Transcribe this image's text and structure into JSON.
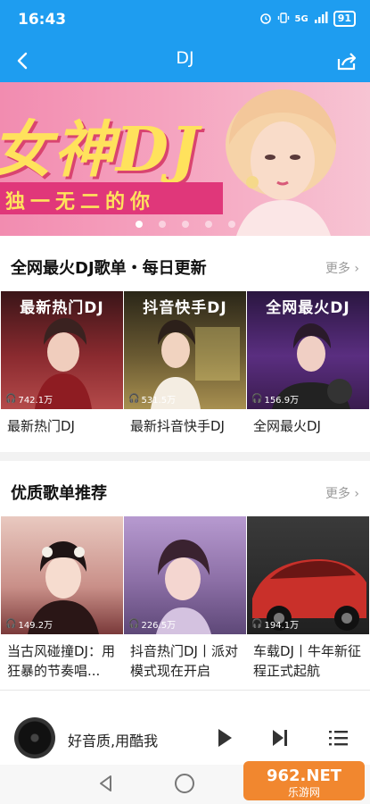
{
  "status_bar": {
    "time": "16:43",
    "network": "5G",
    "battery": "91"
  },
  "nav": {
    "title": "DJ",
    "back_icon": "chevron-left-icon",
    "share_icon": "share-icon"
  },
  "banner": {
    "title": "女神DJ",
    "subtitle": "独一无二的你",
    "dot_count": 5,
    "active_dot": 0
  },
  "section1": {
    "title": "全网最火DJ歌单・每日更新",
    "more": "更多",
    "items": [
      {
        "caption": "最新热门DJ",
        "count": "742.1万",
        "name": "最新热门DJ",
        "color": "#8a2a2f"
      },
      {
        "caption": "抖音快手DJ",
        "count": "531.5万",
        "name": "最新抖音快手DJ",
        "color": "#5a4a30"
      },
      {
        "caption": "全网最火DJ",
        "count": "156.9万",
        "name": "全网最火DJ",
        "color": "#4a2a6a"
      }
    ]
  },
  "section2": {
    "title": "优质歌单推荐",
    "more": "更多",
    "items": [
      {
        "count": "149.2万",
        "name": "当古风碰撞DJ：用狂暴的节奏唱...",
        "color": "#c9a3a0"
      },
      {
        "count": "226.5万",
        "name": "抖音热门DJ丨派对模式现在开启",
        "color": "#8c6fa6"
      },
      {
        "count": "194.1万",
        "name": "车载DJ丨牛年新征程正式起航",
        "color": "#c13a2e"
      }
    ]
  },
  "player": {
    "text": "好音质,用酷我",
    "play_icon": "play-icon",
    "next_icon": "skip-next-icon",
    "list_icon": "playlist-icon"
  },
  "watermark": {
    "brand": "962.NET",
    "sub": "乐游网"
  }
}
